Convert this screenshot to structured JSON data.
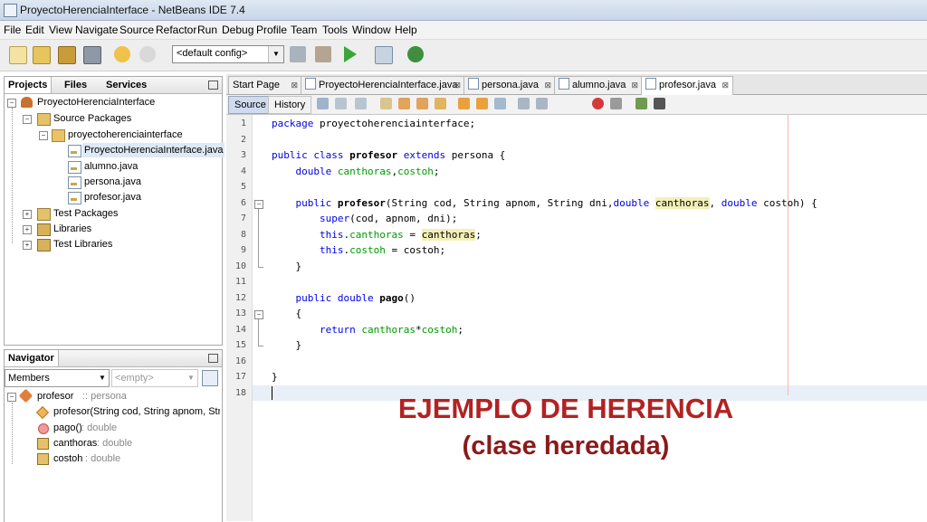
{
  "window": {
    "title": "ProyectoHerenciaInterface - NetBeans IDE 7.4"
  },
  "menu": [
    "File",
    "Edit",
    "View",
    "Navigate",
    "Source",
    "Refactor",
    "Run",
    "Debug",
    "Profile",
    "Team",
    "Tools",
    "Window",
    "Help"
  ],
  "toolbar": {
    "config": "<default config>"
  },
  "projects_panel": {
    "tabs": [
      "Projects",
      "Files",
      "Services"
    ],
    "tree": {
      "project": "ProyectoHerenciaInterface",
      "source_packages": "Source Packages",
      "package": "proyectoherenciainterface",
      "files": [
        "ProyectoHerenciaInterface.java",
        "alumno.java",
        "persona.java",
        "profesor.java"
      ],
      "test_packages": "Test Packages",
      "libraries": "Libraries",
      "test_libraries": "Test Libraries"
    }
  },
  "navigator": {
    "tab": "Navigator",
    "filter": "Members",
    "empty": "<empty>",
    "root_name": "profesor",
    "root_type": ":: persona",
    "members": [
      {
        "name": "profesor(String cod, String apnom, String dn",
        "type": ""
      },
      {
        "name": "pago()",
        "type": " : double"
      },
      {
        "name": "canthoras",
        "type": " : double"
      },
      {
        "name": "costoh",
        "type": " : double"
      }
    ]
  },
  "editor": {
    "tabs": [
      "Start Page",
      "ProyectoHerenciaInterface.java",
      "persona.java",
      "alumno.java",
      "profesor.java"
    ],
    "source_label": "Source",
    "history_label": "History",
    "line_numbers": [
      "1",
      "2",
      "3",
      "4",
      "5",
      "6",
      "7",
      "8",
      "9",
      "10",
      "11",
      "12",
      "13",
      "14",
      "15",
      "16",
      "17",
      "18"
    ],
    "code": {
      "l1": {
        "kw": "package",
        "rest": " proyectoherenciainterface;"
      },
      "l3": {
        "kw1": "public class",
        "name": "profesor",
        "kw2": "extends",
        "rest": "persona {"
      },
      "l4": {
        "type": "double",
        "fields": "canthoras",
        "comma": ",",
        "f2": "costoh",
        "end": ";"
      },
      "l6": {
        "kw": "public",
        "name": "profesor",
        "args": "(String cod, String apnom, String dni,",
        "t1": "double",
        "p1": "canthoras",
        "sep": ",",
        "t2": "double",
        "p2": "costoh) {"
      },
      "l7": {
        "kw": "super",
        "rest": "(cod, apnom, dni);"
      },
      "l8": {
        "kw": "this",
        "dot": ".",
        "fld": "canthoras",
        "eq": " = ",
        "val": "canthoras",
        "end": ";"
      },
      "l9": {
        "kw": "this",
        "dot": ".",
        "fld": "costoh",
        "rest": " = costoh;"
      },
      "l10": "}",
      "l12": {
        "kw": "public double",
        "name": "pago",
        "rest": "()"
      },
      "l13": "{",
      "l14": {
        "kw": "return",
        "f1": "canthoras",
        "op": "*",
        "f2": "costoh",
        "end": ";"
      },
      "l15": "}",
      "l17": "}"
    }
  },
  "overlay": {
    "line1": "EJEMPLO DE HERENCIA",
    "line2": "(clase heredada)"
  },
  "colors": {
    "keyword": "#0000e6",
    "field": "#009900",
    "highlight": "#f2f0b6",
    "overlay_title": "#b22222"
  }
}
